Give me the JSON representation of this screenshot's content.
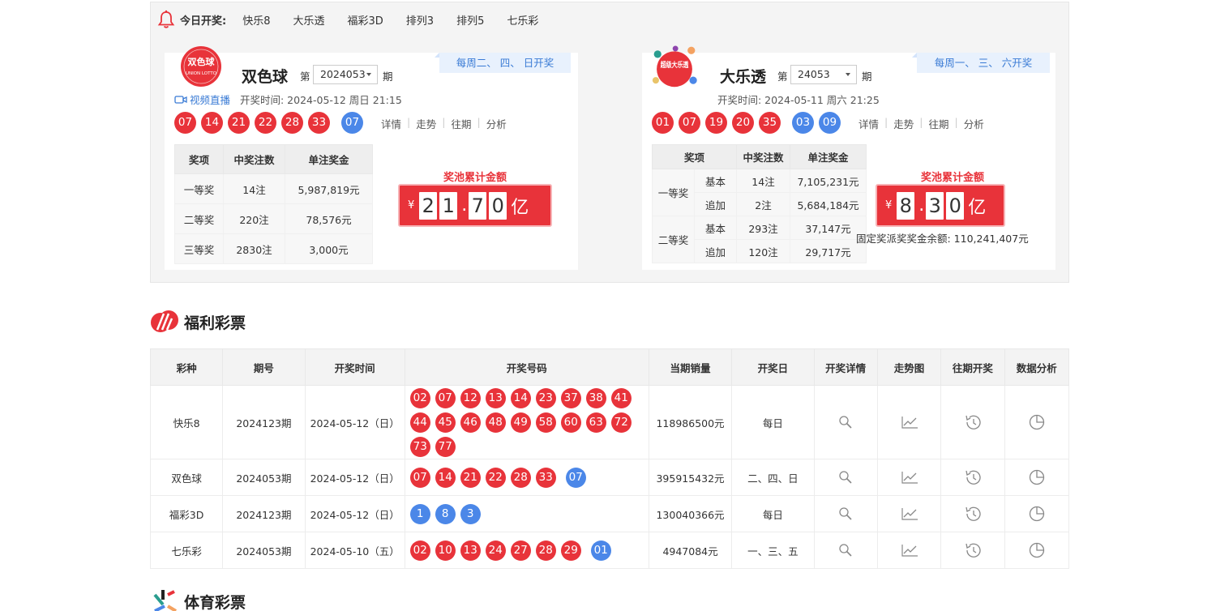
{
  "today": {
    "label": "今日开奖:",
    "games": [
      "快乐8",
      "大乐透",
      "福彩3D",
      "排列3",
      "排列5",
      "七乐彩"
    ]
  },
  "ssq": {
    "logo_text": "双色球",
    "logo_sub": "UNION LOTTO",
    "name": "双色球",
    "di": "第",
    "issue": "2024053",
    "qi": "期",
    "schedule": "每周二、 四、 日开奖",
    "live": "视频直播",
    "draw_time": "开奖时间: 2024-05-12 周日  21:15",
    "red": [
      "07",
      "14",
      "21",
      "22",
      "28",
      "33"
    ],
    "blue": [
      "07"
    ],
    "links": [
      "详情",
      "走势",
      "往期",
      "分析"
    ],
    "table_headers": [
      "奖项",
      "中奖注数",
      "单注奖金"
    ],
    "rows": [
      {
        "level": "一等奖",
        "count": "14注",
        "amount": "5,987,819元"
      },
      {
        "level": "二等奖",
        "count": "220注",
        "amount": "78,576元"
      },
      {
        "level": "三等奖",
        "count": "2830注",
        "amount": "3,000元"
      }
    ],
    "pool_label": "奖池累计金额",
    "pool_yen": "¥",
    "pool_digits": [
      "2",
      "1",
      ".",
      "7",
      "0"
    ],
    "pool_unit": "亿"
  },
  "dlt": {
    "logo_text": "超级大乐透",
    "name": "大乐透",
    "di": "第",
    "issue": "24053",
    "qi": "期",
    "schedule": "每周一、 三、 六开奖",
    "draw_time": "开奖时间: 2024-05-11 周六  21:25",
    "red": [
      "01",
      "07",
      "19",
      "20",
      "35"
    ],
    "blue": [
      "03",
      "09"
    ],
    "links": [
      "详情",
      "走势",
      "往期",
      "分析"
    ],
    "table_headers": [
      "奖项",
      "中奖注数",
      "单注奖金"
    ],
    "rows": [
      {
        "level": "一等奖",
        "sub": "基本",
        "count": "14注",
        "amount": "7,105,231元"
      },
      {
        "level": "",
        "sub": "追加",
        "count": "2注",
        "amount": "5,684,184元"
      },
      {
        "level": "二等奖",
        "sub": "基本",
        "count": "293注",
        "amount": "37,147元"
      },
      {
        "level": "",
        "sub": "追加",
        "count": "120注",
        "amount": "29,717元"
      }
    ],
    "pool_label": "奖池累计金额",
    "pool_yen": "¥",
    "pool_digits": [
      "8",
      ".",
      "3",
      "0"
    ],
    "pool_unit": "亿",
    "fixed_prize": "固定奖派奖奖金余额: 110,241,407元"
  },
  "welfare": {
    "title": "福利彩票",
    "headers": [
      "彩种",
      "期号",
      "开奖时间",
      "开奖号码",
      "当期销量",
      "开奖日",
      "开奖详情",
      "走势图",
      "往期开奖",
      "数据分析"
    ],
    "rows": [
      {
        "game": "快乐8",
        "issue": "2024123期",
        "time": "2024-05-12（日）",
        "red": [
          "02",
          "07",
          "12",
          "13",
          "14",
          "23",
          "37",
          "38",
          "41",
          "44",
          "45",
          "46",
          "48",
          "49",
          "58",
          "60",
          "63",
          "72",
          "73",
          "77"
        ],
        "blue": [],
        "sales": "118986500元",
        "day": "每日"
      },
      {
        "game": "双色球",
        "issue": "2024053期",
        "time": "2024-05-12（日）",
        "red": [
          "07",
          "14",
          "21",
          "22",
          "28",
          "33"
        ],
        "blue": [
          "07"
        ],
        "sales": "395915432元",
        "day": "二、四、日"
      },
      {
        "game": "福彩3D",
        "issue": "2024123期",
        "time": "2024-05-12（日）",
        "red": [],
        "blue": [
          "1",
          "8",
          "3"
        ],
        "sales": "130040366元",
        "day": "每日"
      },
      {
        "game": "七乐彩",
        "issue": "2024053期",
        "time": "2024-05-10（五）",
        "red": [
          "02",
          "10",
          "13",
          "24",
          "27",
          "28",
          "29"
        ],
        "blue": [
          "01"
        ],
        "sales": "4947084元",
        "day": "一、三、五"
      }
    ]
  },
  "sports": {
    "title": "体育彩票"
  },
  "colors": {
    "red_ball": "#e8333a",
    "blue_ball": "#4b87e8",
    "accent_blue": "#3a7bd5"
  },
  "icons": [
    "bell-icon",
    "video-icon",
    "search-icon",
    "trend-icon",
    "history-icon",
    "pie-icon"
  ]
}
